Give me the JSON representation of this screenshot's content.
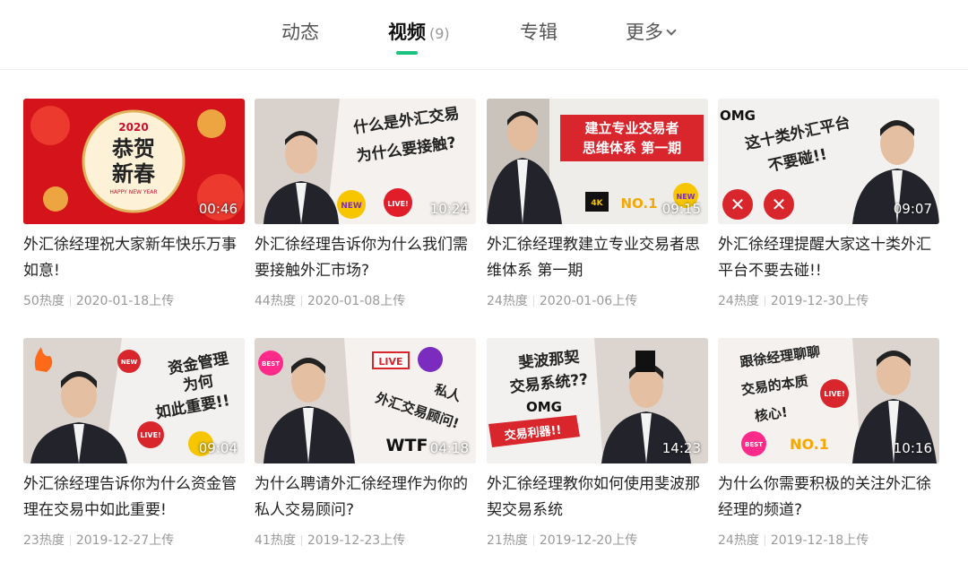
{
  "tabs": [
    {
      "label": "动态"
    },
    {
      "label": "视频",
      "count": "(9)",
      "active": true
    },
    {
      "label": "专辑"
    },
    {
      "label": "更多"
    }
  ],
  "videos": [
    {
      "duration": "00:46",
      "title": "外汇徐经理祝大家新年快乐万事如意!",
      "heat": "50热度",
      "date": "2020-01-18上传",
      "thumb_text": [
        "2020",
        "恭贺",
        "新春",
        "HAPPY NEW YEAR"
      ]
    },
    {
      "duration": "10:24",
      "title": "外汇徐经理告诉你为什么我们需要接触外汇市场?",
      "heat": "44热度",
      "date": "2020-01-08上传",
      "thumb_text": [
        "什么是外汇交易",
        "为什么要接触?",
        "NEW",
        "LIVE!"
      ]
    },
    {
      "duration": "09:15",
      "title": "外汇徐经理教建立专业交易者思维体系 第一期",
      "heat": "24热度",
      "date": "2020-01-06上传",
      "thumb_text": [
        "建立专业交易者",
        "思维体系 第一期",
        "4K",
        "NO.1",
        "NEW"
      ]
    },
    {
      "duration": "09:07",
      "title": "外汇徐经理提醒大家这十类外汇平台不要去碰!!",
      "heat": "24热度",
      "date": "2019-12-30上传",
      "thumb_text": [
        "OMG",
        "这十类外汇平台",
        "不要碰!!"
      ]
    },
    {
      "duration": "09:04",
      "title": "外汇徐经理告诉你为什么资金管理在交易中如此重要!",
      "heat": "23热度",
      "date": "2019-12-27上传",
      "thumb_text": [
        "资金管理",
        "为何",
        "如此重要!!",
        "NEW",
        "LIVE!"
      ]
    },
    {
      "duration": "04:18",
      "title": "为什么聘请外汇徐经理作为你的私人交易顾问?",
      "heat": "41热度",
      "date": "2019-12-23上传",
      "thumb_text": [
        "LIVE",
        "私人",
        "外汇交易顾问!",
        "BEST",
        "WTF"
      ]
    },
    {
      "duration": "14:23",
      "title": "外汇徐经理教你如何使用斐波那契交易系统",
      "heat": "21热度",
      "date": "2019-12-20上传",
      "thumb_text": [
        "斐波那契",
        "交易系统??",
        "OMG",
        "交易利器!!"
      ]
    },
    {
      "duration": "10:16",
      "title": "为什么你需要积极的关注外汇徐经理的频道?",
      "heat": "24热度",
      "date": "2019-12-18上传",
      "thumb_text": [
        "跟徐经理聊聊",
        "交易的本质",
        "核心!",
        "LIVE!",
        "BEST",
        "NO.1"
      ]
    }
  ],
  "colors": {
    "accent": "#19c37d",
    "meta": "#999999",
    "title": "#222222"
  }
}
